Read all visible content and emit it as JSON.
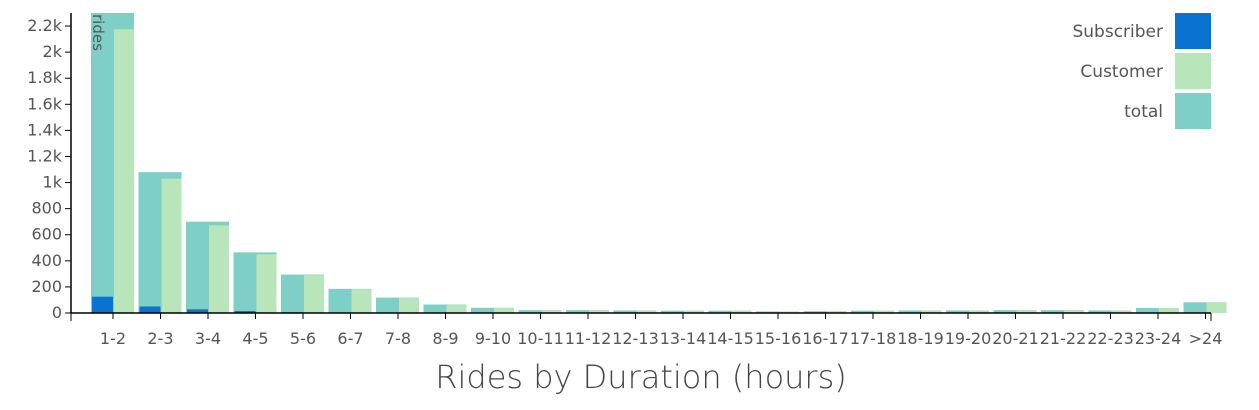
{
  "chart_data": {
    "type": "bar",
    "xlabel": "Rides by Duration (hours)",
    "ylabel": "rides",
    "ylim": [
      0,
      2300
    ],
    "y_ticks": [
      0,
      200,
      400,
      600,
      800,
      1000,
      1200,
      1400,
      1600,
      1800,
      2000,
      2200
    ],
    "y_tick_labels": [
      "0",
      "200",
      "400",
      "600",
      "800",
      "1k",
      "1.2k",
      "1.4k",
      "1.6k",
      "1.8k",
      "2k",
      "2.2k"
    ],
    "categories": [
      "1-2",
      "2-3",
      "3-4",
      "4-5",
      "5-6",
      "6-7",
      "7-8",
      "8-9",
      "9-10",
      "10-11",
      "11-12",
      "12-13",
      "13-14",
      "14-15",
      "15-16",
      "16-17",
      "17-18",
      "18-19",
      "19-20",
      "20-21",
      "21-22",
      "22-23",
      "23-24",
      ">24"
    ],
    "series": [
      {
        "name": "total",
        "color": "#7ecfc6",
        "values": [
          2300,
          1080,
          700,
          465,
          295,
          185,
          118,
          65,
          40,
          22,
          22,
          20,
          18,
          18,
          12,
          14,
          18,
          20,
          20,
          22,
          22,
          20,
          38,
          82
        ]
      },
      {
        "name": "Subscriber",
        "color": "#0a72d0",
        "values": [
          125,
          50,
          28,
          15,
          5,
          3,
          2,
          2,
          1,
          1,
          1,
          1,
          1,
          1,
          1,
          1,
          1,
          1,
          1,
          1,
          1,
          1,
          1,
          2
        ]
      },
      {
        "name": "Customer",
        "color": "#b9e5bb",
        "values": [
          2175,
          1030,
          672,
          450,
          290,
          182,
          116,
          63,
          39,
          21,
          21,
          19,
          17,
          17,
          11,
          13,
          17,
          19,
          19,
          21,
          21,
          19,
          37,
          80
        ]
      }
    ],
    "legend": [
      {
        "name": "Subscriber",
        "color": "#0a72d0"
      },
      {
        "name": "Customer",
        "color": "#b9e5bb"
      },
      {
        "name": "total",
        "color": "#7ecfc6"
      }
    ],
    "legend_position": "top-right",
    "grid": false
  }
}
